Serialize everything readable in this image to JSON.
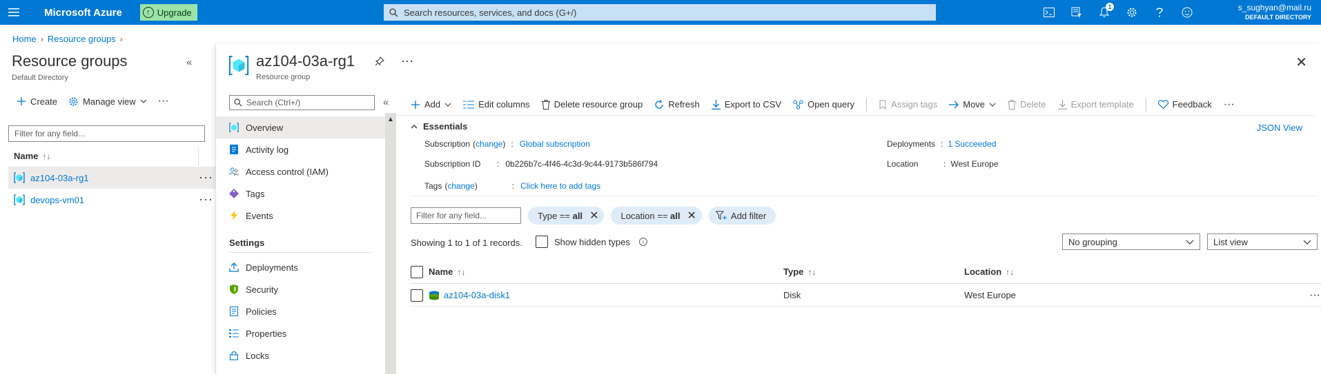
{
  "topbar": {
    "brand": "Microsoft Azure",
    "upgrade": "Upgrade",
    "search_placeholder": "Search resources, services, and docs (G+/)",
    "notification_count": "1",
    "user_email": "s_sughyan@mail.ru",
    "user_directory": "DEFAULT DIRECTORY",
    "icons": [
      "cloud-shell-icon",
      "directory-filter-icon",
      "bell-icon",
      "gear-icon",
      "help-icon",
      "feedback-smiley-icon"
    ]
  },
  "breadcrumb": {
    "home": "Home",
    "resource_groups": "Resource groups"
  },
  "left": {
    "title": "Resource groups",
    "subtitle": "Default Directory",
    "create": "Create",
    "manage_view": "Manage view",
    "filter_placeholder": "Filter for any field...",
    "name_header": "Name",
    "items": [
      {
        "name": "az104-03a-rg1",
        "selected": true
      },
      {
        "name": "devops-vm01",
        "selected": false
      }
    ]
  },
  "blade": {
    "title": "az104-03a-rg1",
    "subtitle": "Resource group",
    "menu": {
      "search_placeholder": "Search (Ctrl+/)",
      "items": [
        {
          "label": "Overview",
          "icon": "resource-group-icon",
          "selected": true
        },
        {
          "label": "Activity log",
          "icon": "activity-log-icon"
        },
        {
          "label": "Access control (IAM)",
          "icon": "iam-people-icon"
        },
        {
          "label": "Tags",
          "icon": "tag-icon"
        },
        {
          "label": "Events",
          "icon": "lightning-icon"
        }
      ],
      "settings_header": "Settings",
      "settings": [
        {
          "label": "Deployments",
          "icon": "deployments-upload-icon"
        },
        {
          "label": "Security",
          "icon": "shield-icon"
        },
        {
          "label": "Policies",
          "icon": "policy-icon"
        },
        {
          "label": "Properties",
          "icon": "properties-icon"
        },
        {
          "label": "Locks",
          "icon": "lock-icon"
        }
      ]
    },
    "commands": {
      "add": "Add",
      "edit_columns": "Edit columns",
      "delete_rg": "Delete resource group",
      "refresh": "Refresh",
      "export_csv": "Export to CSV",
      "open_query": "Open query",
      "assign_tags": "Assign tags",
      "move": "Move",
      "delete": "Delete",
      "export_template": "Export template",
      "feedback": "Feedback"
    },
    "essentials": {
      "header": "Essentials",
      "json_view": "JSON View",
      "subscription_label": "Subscription",
      "change": "change",
      "subscription_value": "Global subscription",
      "subscription_id_label": "Subscription ID",
      "subscription_id_value": "0b226b7c-4f46-4c3d-9c44-9173b586f794",
      "tags_label": "Tags",
      "tags_value": "Click here to add tags",
      "deployments_label": "Deployments",
      "deployments_value": "1 Succeeded",
      "location_label": "Location",
      "location_value": "West Europe"
    },
    "filters": {
      "filter_placeholder": "Filter for any field...",
      "type_label": "Type == ",
      "type_value": "all",
      "location_label": "Location == ",
      "location_value": "all",
      "add_filter": "Add filter"
    },
    "records": "Showing 1 to 1 of 1 records.",
    "show_hidden": "Show hidden types",
    "grouping": "No grouping",
    "view": "List view",
    "grid": {
      "headers": {
        "name": "Name",
        "type": "Type",
        "location": "Location"
      },
      "rows": [
        {
          "name": "az104-03a-disk1",
          "type": "Disk",
          "location": "West Europe"
        }
      ]
    }
  }
}
